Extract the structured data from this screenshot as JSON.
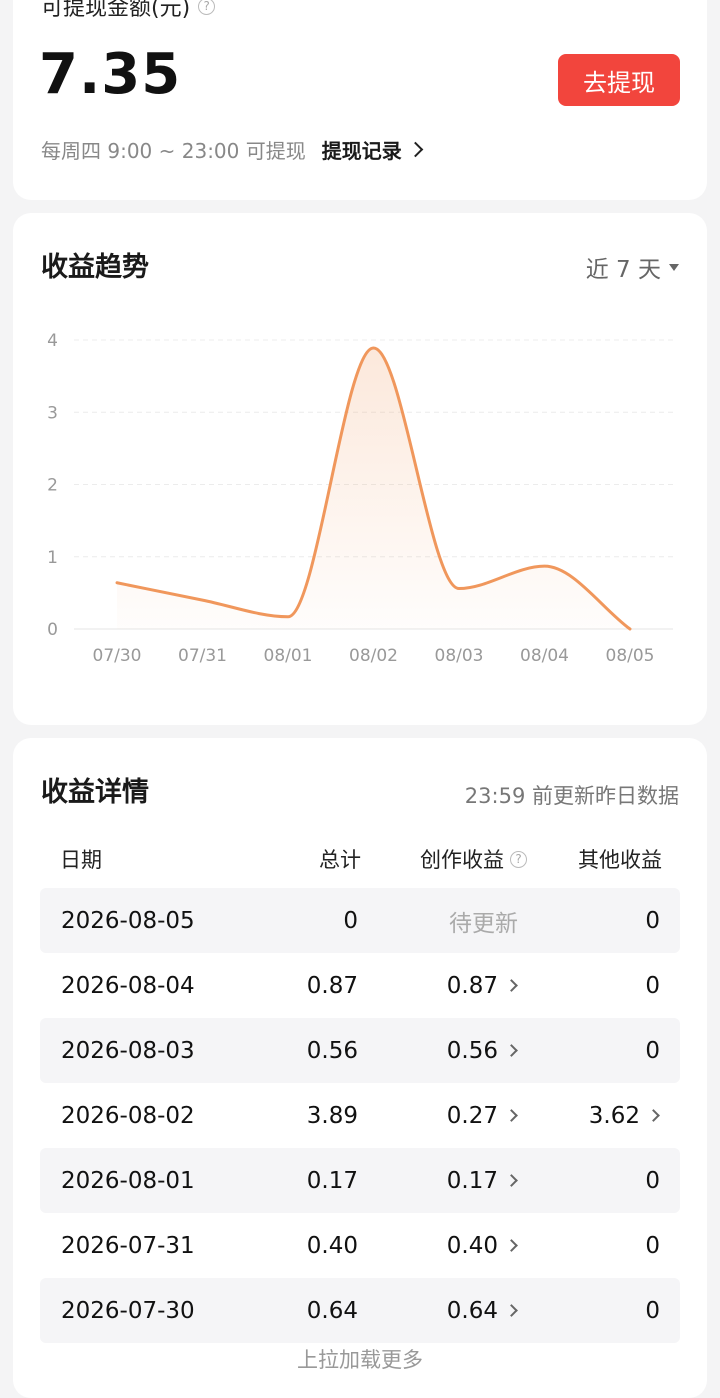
{
  "balance": {
    "label": "可提现金额(元)",
    "help_icon": "question-circle-icon",
    "amount": "7.35",
    "withdraw_button": "去提现",
    "schedule": "每周四 9:00 ~ 23:00 可提现",
    "record_link": "提现记录"
  },
  "trend": {
    "title": "收益趋势",
    "range_label": "近 7 天"
  },
  "chart_data": {
    "type": "area",
    "categories": [
      "07/30",
      "07/31",
      "08/01",
      "08/02",
      "08/03",
      "08/04",
      "08/05"
    ],
    "series": [
      {
        "values": [
          0.64,
          0.4,
          0.17,
          3.89,
          0.56,
          0.87,
          0
        ]
      }
    ],
    "yticks": [
      "0",
      "1",
      "2",
      "3",
      "4"
    ],
    "ylim": [
      0,
      4
    ],
    "grid": true,
    "color": "#f0975c"
  },
  "detail": {
    "title": "收益详情",
    "update_note": "23:59 前更新昨日数据",
    "headers": {
      "date": "日期",
      "total": "总计",
      "creation": "创作收益",
      "other": "其他收益"
    },
    "rows": [
      {
        "date": "2026-08-05",
        "total": "0",
        "creation": "待更新",
        "other": "0"
      },
      {
        "date": "2026-08-04",
        "total": "0.87",
        "creation": "0.87",
        "other": "0"
      },
      {
        "date": "2026-08-03",
        "total": "0.56",
        "creation": "0.56",
        "other": "0"
      },
      {
        "date": "2026-08-02",
        "total": "3.89",
        "creation": "0.27",
        "other": "3.62"
      },
      {
        "date": "2026-08-01",
        "total": "0.17",
        "creation": "0.17",
        "other": "0"
      },
      {
        "date": "2026-07-31",
        "total": "0.40",
        "creation": "0.40",
        "other": "0"
      },
      {
        "date": "2026-07-30",
        "total": "0.64",
        "creation": "0.64",
        "other": "0"
      }
    ],
    "load_more": "上拉加载更多"
  }
}
